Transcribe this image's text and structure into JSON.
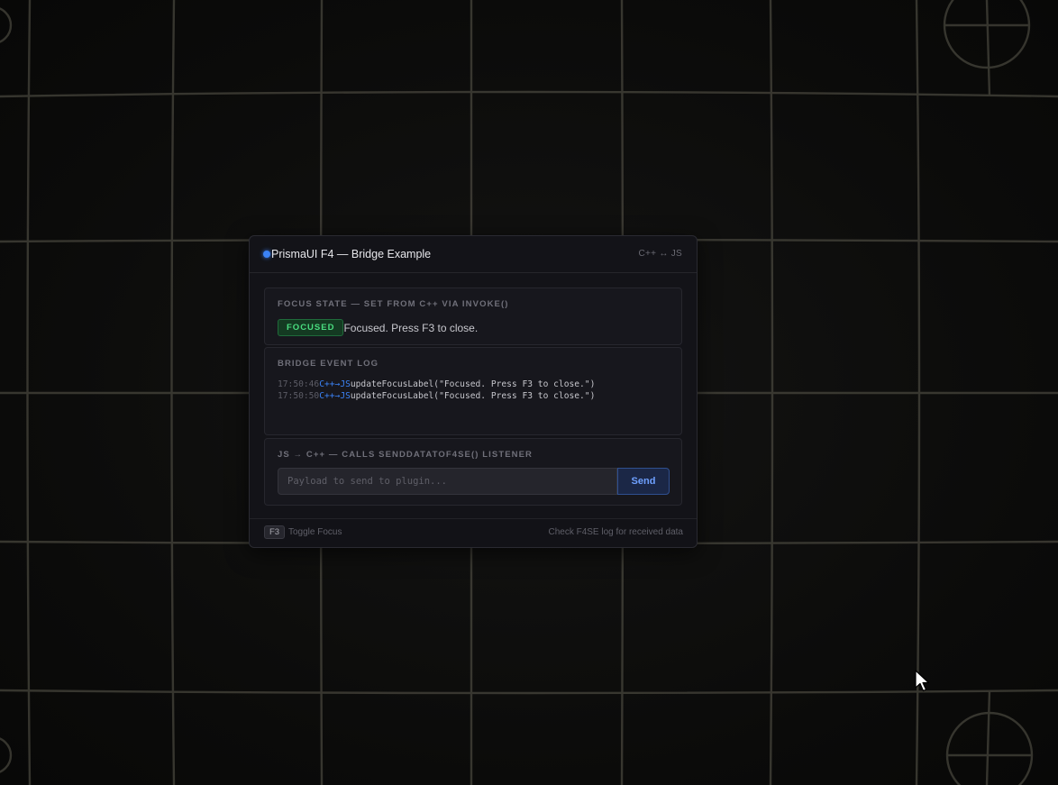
{
  "window": {
    "title": "PrismaUI F4 — Bridge Example",
    "bridge_tag": "C++ ↔ JS",
    "status_color": "#3b82f6"
  },
  "focus_section": {
    "label": "Focus State — set from C++ via invoke()",
    "badge": "FOCUSED",
    "badge_color": "#4ade80",
    "status_text": "Focused. Press F3 to close."
  },
  "log_section": {
    "label": "Bridge Event Log",
    "entries": [
      {
        "time": "17:50:46",
        "direction": "C++→JS",
        "message": "updateFocusLabel(\"Focused. Press F3 to close.\")"
      },
      {
        "time": "17:50:50",
        "direction": "C++→JS",
        "message": "updateFocusLabel(\"Focused. Press F3 to close.\")"
      }
    ]
  },
  "send_section": {
    "label": "JS → C++ — calls sendDataToF4SE() listener",
    "input_placeholder": "Payload to send to plugin...",
    "input_value": "",
    "send_label": "Send",
    "accent_color": "#6ea0ff"
  },
  "footer": {
    "key": "F3",
    "key_hint": "Toggle Focus",
    "note": "Check F4SE log for received data"
  }
}
